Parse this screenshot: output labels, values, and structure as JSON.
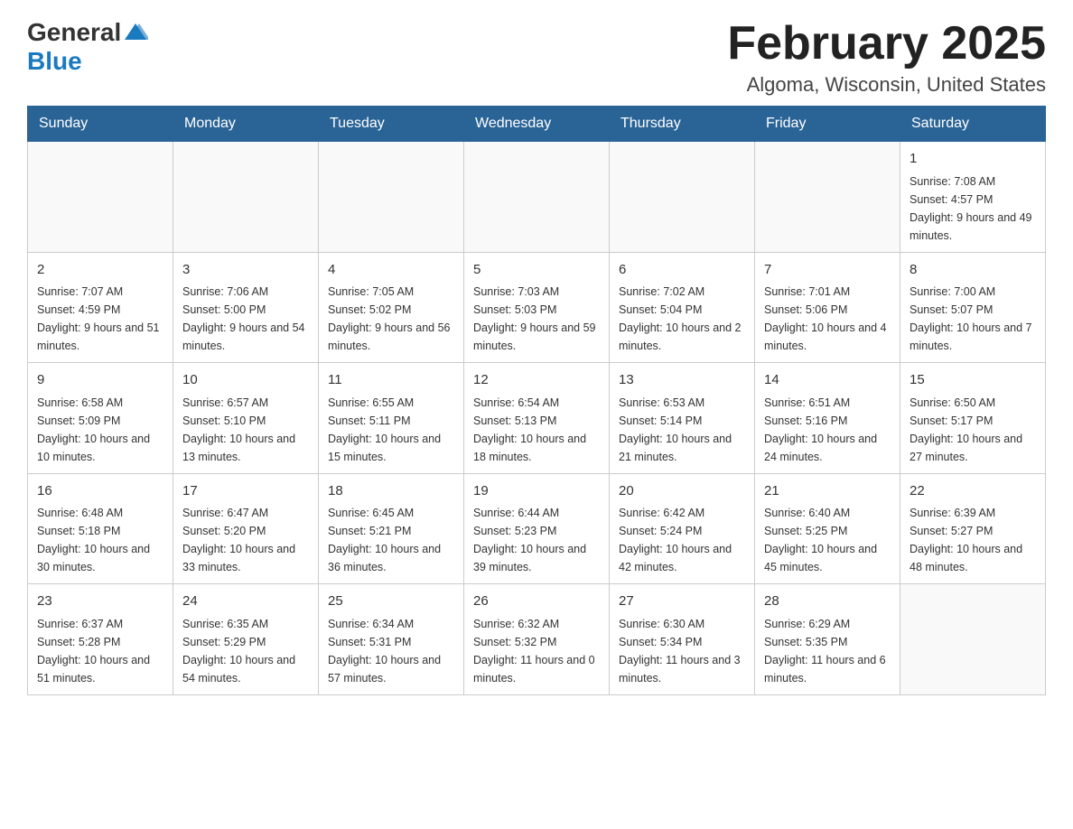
{
  "header": {
    "logo_general": "General",
    "logo_blue": "Blue",
    "month_title": "February 2025",
    "location": "Algoma, Wisconsin, United States"
  },
  "days_of_week": [
    "Sunday",
    "Monday",
    "Tuesday",
    "Wednesday",
    "Thursday",
    "Friday",
    "Saturday"
  ],
  "weeks": [
    [
      {
        "day": "",
        "info": ""
      },
      {
        "day": "",
        "info": ""
      },
      {
        "day": "",
        "info": ""
      },
      {
        "day": "",
        "info": ""
      },
      {
        "day": "",
        "info": ""
      },
      {
        "day": "",
        "info": ""
      },
      {
        "day": "1",
        "info": "Sunrise: 7:08 AM\nSunset: 4:57 PM\nDaylight: 9 hours\nand 49 minutes."
      }
    ],
    [
      {
        "day": "2",
        "info": "Sunrise: 7:07 AM\nSunset: 4:59 PM\nDaylight: 9 hours\nand 51 minutes."
      },
      {
        "day": "3",
        "info": "Sunrise: 7:06 AM\nSunset: 5:00 PM\nDaylight: 9 hours\nand 54 minutes."
      },
      {
        "day": "4",
        "info": "Sunrise: 7:05 AM\nSunset: 5:02 PM\nDaylight: 9 hours\nand 56 minutes."
      },
      {
        "day": "5",
        "info": "Sunrise: 7:03 AM\nSunset: 5:03 PM\nDaylight: 9 hours\nand 59 minutes."
      },
      {
        "day": "6",
        "info": "Sunrise: 7:02 AM\nSunset: 5:04 PM\nDaylight: 10 hours\nand 2 minutes."
      },
      {
        "day": "7",
        "info": "Sunrise: 7:01 AM\nSunset: 5:06 PM\nDaylight: 10 hours\nand 4 minutes."
      },
      {
        "day": "8",
        "info": "Sunrise: 7:00 AM\nSunset: 5:07 PM\nDaylight: 10 hours\nand 7 minutes."
      }
    ],
    [
      {
        "day": "9",
        "info": "Sunrise: 6:58 AM\nSunset: 5:09 PM\nDaylight: 10 hours\nand 10 minutes."
      },
      {
        "day": "10",
        "info": "Sunrise: 6:57 AM\nSunset: 5:10 PM\nDaylight: 10 hours\nand 13 minutes."
      },
      {
        "day": "11",
        "info": "Sunrise: 6:55 AM\nSunset: 5:11 PM\nDaylight: 10 hours\nand 15 minutes."
      },
      {
        "day": "12",
        "info": "Sunrise: 6:54 AM\nSunset: 5:13 PM\nDaylight: 10 hours\nand 18 minutes."
      },
      {
        "day": "13",
        "info": "Sunrise: 6:53 AM\nSunset: 5:14 PM\nDaylight: 10 hours\nand 21 minutes."
      },
      {
        "day": "14",
        "info": "Sunrise: 6:51 AM\nSunset: 5:16 PM\nDaylight: 10 hours\nand 24 minutes."
      },
      {
        "day": "15",
        "info": "Sunrise: 6:50 AM\nSunset: 5:17 PM\nDaylight: 10 hours\nand 27 minutes."
      }
    ],
    [
      {
        "day": "16",
        "info": "Sunrise: 6:48 AM\nSunset: 5:18 PM\nDaylight: 10 hours\nand 30 minutes."
      },
      {
        "day": "17",
        "info": "Sunrise: 6:47 AM\nSunset: 5:20 PM\nDaylight: 10 hours\nand 33 minutes."
      },
      {
        "day": "18",
        "info": "Sunrise: 6:45 AM\nSunset: 5:21 PM\nDaylight: 10 hours\nand 36 minutes."
      },
      {
        "day": "19",
        "info": "Sunrise: 6:44 AM\nSunset: 5:23 PM\nDaylight: 10 hours\nand 39 minutes."
      },
      {
        "day": "20",
        "info": "Sunrise: 6:42 AM\nSunset: 5:24 PM\nDaylight: 10 hours\nand 42 minutes."
      },
      {
        "day": "21",
        "info": "Sunrise: 6:40 AM\nSunset: 5:25 PM\nDaylight: 10 hours\nand 45 minutes."
      },
      {
        "day": "22",
        "info": "Sunrise: 6:39 AM\nSunset: 5:27 PM\nDaylight: 10 hours\nand 48 minutes."
      }
    ],
    [
      {
        "day": "23",
        "info": "Sunrise: 6:37 AM\nSunset: 5:28 PM\nDaylight: 10 hours\nand 51 minutes."
      },
      {
        "day": "24",
        "info": "Sunrise: 6:35 AM\nSunset: 5:29 PM\nDaylight: 10 hours\nand 54 minutes."
      },
      {
        "day": "25",
        "info": "Sunrise: 6:34 AM\nSunset: 5:31 PM\nDaylight: 10 hours\nand 57 minutes."
      },
      {
        "day": "26",
        "info": "Sunrise: 6:32 AM\nSunset: 5:32 PM\nDaylight: 11 hours\nand 0 minutes."
      },
      {
        "day": "27",
        "info": "Sunrise: 6:30 AM\nSunset: 5:34 PM\nDaylight: 11 hours\nand 3 minutes."
      },
      {
        "day": "28",
        "info": "Sunrise: 6:29 AM\nSunset: 5:35 PM\nDaylight: 11 hours\nand 6 minutes."
      },
      {
        "day": "",
        "info": ""
      }
    ]
  ]
}
